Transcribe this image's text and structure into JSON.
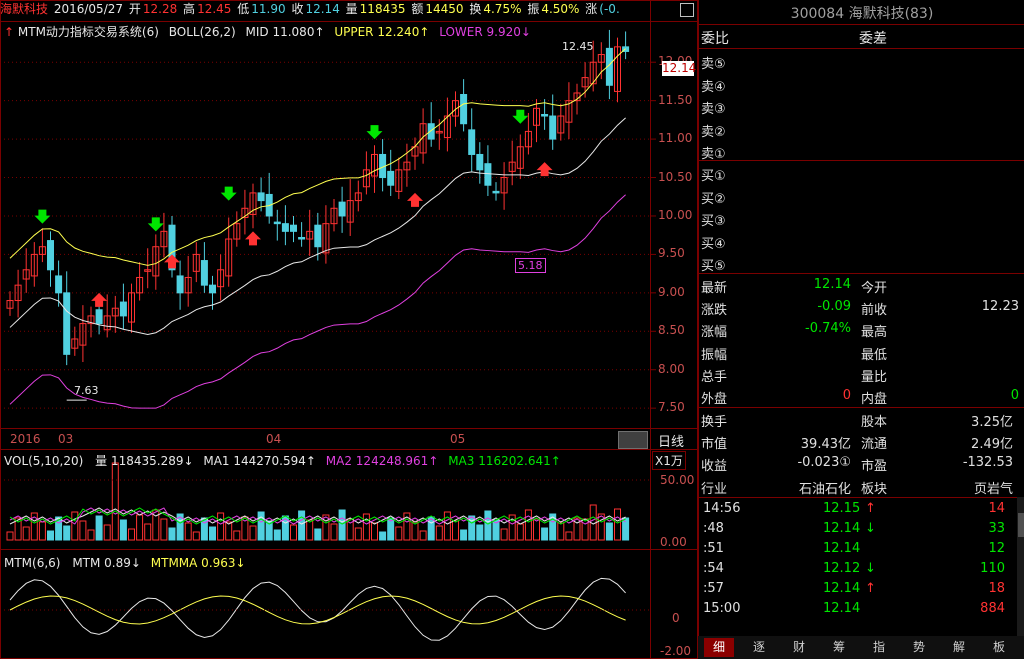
{
  "header": {
    "stock_name": "海默科技",
    "date": "2016/05/27",
    "open_label": "开",
    "open": "12.28",
    "high_label": "高",
    "high": "12.45",
    "low_label": "低",
    "low": "11.90",
    "close_label": "收",
    "close": "12.14",
    "vol_label": "量",
    "vol": "118435",
    "amount_label": "额",
    "amount": "14450",
    "turnover_label": "换",
    "turnover": "4.75%",
    "amplitude_label": "振",
    "amplitude": "4.50%",
    "change_label": "涨",
    "change": "(-0."
  },
  "indicator_line": {
    "system": "MTM动力指标交易系统(6)",
    "boll": "BOLL(26,2)",
    "mid": "MID 11.080↑",
    "upper": "UPPER 12.240↑",
    "lower": "LOWER 9.920↓"
  },
  "price_axis": [
    "12.00",
    "11.50",
    "11.00",
    "10.50",
    "10.00",
    "9.50",
    "9.00",
    "8.50",
    "8.00",
    "7.50"
  ],
  "price_tag": "12.14",
  "annotations": {
    "high_label": "12.45",
    "low_label": "7.63",
    "date_box": "5.18"
  },
  "date_axis": {
    "year": "2016",
    "months": [
      "03",
      "04",
      "05"
    ],
    "period": "日线"
  },
  "volume_panel": {
    "title": "VOL(5,10,20)",
    "vol": "量 118435.289↓",
    "ma1": "MA1 144270.594↑",
    "ma2": "MA2 124248.961↑",
    "ma3": "MA3 116202.641↑",
    "unit": "X1万",
    "axis": [
      "50.00",
      "0.00"
    ]
  },
  "mtm_panel": {
    "title": "MTM(6,6)",
    "mtm": "MTM 0.89↓",
    "mtmma": "MTMMA 0.963↓",
    "axis": [
      "0",
      "-2.00"
    ]
  },
  "quote": {
    "code_title": "300084 海默科技(83)",
    "weibi": "委比",
    "weicha": "委差",
    "sells": [
      "卖⑤",
      "卖④",
      "卖③",
      "卖②",
      "卖①"
    ],
    "buys": [
      "买①",
      "买②",
      "买③",
      "买④",
      "买⑤"
    ],
    "rows": [
      {
        "l1": "最新",
        "v1": "12.14",
        "l2": "今开",
        "v2": ""
      },
      {
        "l1": "涨跌",
        "v1": "-0.09",
        "l2": "前收",
        "v2": "12.23"
      },
      {
        "l1": "涨幅",
        "v1": "-0.74%",
        "l2": "最高",
        "v2": ""
      },
      {
        "l1": "振幅",
        "v1": "",
        "l2": "最低",
        "v2": ""
      },
      {
        "l1": "总手",
        "v1": "",
        "l2": "量比",
        "v2": ""
      },
      {
        "l1": "外盘",
        "v1": "0",
        "l2": "内盘",
        "v2": "0"
      }
    ],
    "rows2": [
      {
        "l1": "换手",
        "v1": "",
        "l2": "股本",
        "v2": "3.25亿"
      },
      {
        "l1": "市值",
        "v1": "39.43亿",
        "l2": "流通",
        "v2": "2.49亿"
      },
      {
        "l1": "收益",
        "v1": "-0.023①",
        "l2": "市盈",
        "v2": "-132.53"
      },
      {
        "l1": "行业",
        "v1": "石油石化",
        "l2": "板块",
        "v2": "页岩气"
      }
    ],
    "ticks": [
      {
        "time": "14:56",
        "price": "12.15",
        "arrow": "↑",
        "vol": "14"
      },
      {
        "time": ":48",
        "price": "12.14",
        "arrow": "↓",
        "vol": "33"
      },
      {
        "time": ":51",
        "price": "12.14",
        "arrow": "",
        "vol": "12"
      },
      {
        "time": ":54",
        "price": "12.12",
        "arrow": "↓",
        "vol": "110"
      },
      {
        "time": ":57",
        "price": "12.14",
        "arrow": "↑",
        "vol": "18"
      },
      {
        "time": "15:00",
        "price": "12.14",
        "arrow": "",
        "vol": "884"
      }
    ]
  },
  "tabs": [
    "细",
    "逐",
    "财",
    "筹",
    "指",
    "势",
    "解",
    "板"
  ],
  "colors": {
    "up": "#ff3232",
    "down": "#50d0e0",
    "grid": "#7a0000",
    "mid": "#e8e8e8",
    "upper": "#ffff50",
    "lower": "#e040e0",
    "accent_green": "#00e600"
  }
}
